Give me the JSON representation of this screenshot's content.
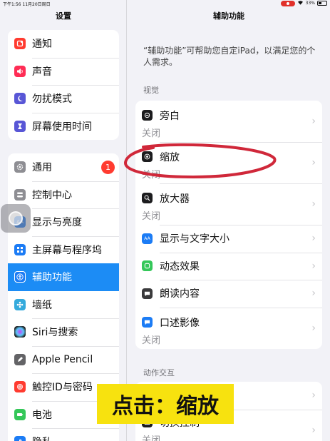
{
  "status_bar": {
    "time_date": "下午1:56  11月20日周日",
    "battery": "33%"
  },
  "sidebar": {
    "title": "设置",
    "group1": [
      {
        "label": "通知",
        "icon": "bell-icon",
        "color": "#ff3b30"
      },
      {
        "label": "声音",
        "icon": "speaker-icon",
        "color": "#ff2d55"
      },
      {
        "label": "勿扰模式",
        "icon": "moon-icon",
        "color": "#5856d6"
      },
      {
        "label": "屏幕使用时间",
        "icon": "hourglass-icon",
        "color": "#5856d6"
      }
    ],
    "group2": [
      {
        "label": "通用",
        "icon": "gear-icon",
        "color": "#8e8e93",
        "badge": "1"
      },
      {
        "label": "控制中心",
        "icon": "switches-icon",
        "color": "#8e8e93"
      },
      {
        "label": "显示与亮度",
        "icon": "aa-icon",
        "color": "#1c7cf5"
      },
      {
        "label": "主屏幕与程序坞",
        "icon": "grid-icon",
        "color": "#1c7cf5"
      },
      {
        "label": "辅助功能",
        "icon": "accessibility-icon",
        "color": "#1c7cf5",
        "active": true
      },
      {
        "label": "墙纸",
        "icon": "flower-icon",
        "color": "#34aadc"
      },
      {
        "label": "Siri与搜索",
        "icon": "siri-icon",
        "color": "#222222"
      },
      {
        "label": "Apple Pencil",
        "icon": "pencil-icon",
        "color": "#636366"
      },
      {
        "label": "触控ID与密码",
        "icon": "fingerprint-icon",
        "color": "#ff3b30"
      },
      {
        "label": "电池",
        "icon": "battery-icon",
        "color": "#34c759"
      },
      {
        "label": "隐私",
        "icon": "hand-icon",
        "color": "#1c7cf5"
      }
    ]
  },
  "main": {
    "title": "辅助功能",
    "description": "“辅助功能”可帮助您自定iPad，以满足您的个人需求。",
    "section_vision": "视觉",
    "vision_items": [
      {
        "label": "旁白",
        "value": "关闭",
        "icon": "voiceover-icon",
        "color": "#1c1c1e"
      },
      {
        "label": "缩放",
        "value": "关闭",
        "icon": "zoom-icon",
        "color": "#1c1c1e"
      },
      {
        "label": "放大器",
        "value": "关闭",
        "icon": "magnifier-icon",
        "color": "#1c1c1e"
      },
      {
        "label": "显示与文字大小",
        "icon": "text-size-icon",
        "color": "#1c7cf5"
      },
      {
        "label": "动态效果",
        "icon": "motion-icon",
        "color": "#34c759"
      },
      {
        "label": "朗读内容",
        "icon": "speech-bubble-icon",
        "color": "#3a3a3c"
      },
      {
        "label": "口述影像",
        "value": "关闭",
        "icon": "audio-description-icon",
        "color": "#1c7cf5"
      }
    ],
    "section_interaction": "动作交互",
    "interaction_items": [
      {
        "label": "",
        "icon": ""
      },
      {
        "label": "切换控制",
        "value": "关闭"
      }
    ]
  },
  "overlay_caption": "点击：缩放",
  "highlight_color": "#d0283a"
}
